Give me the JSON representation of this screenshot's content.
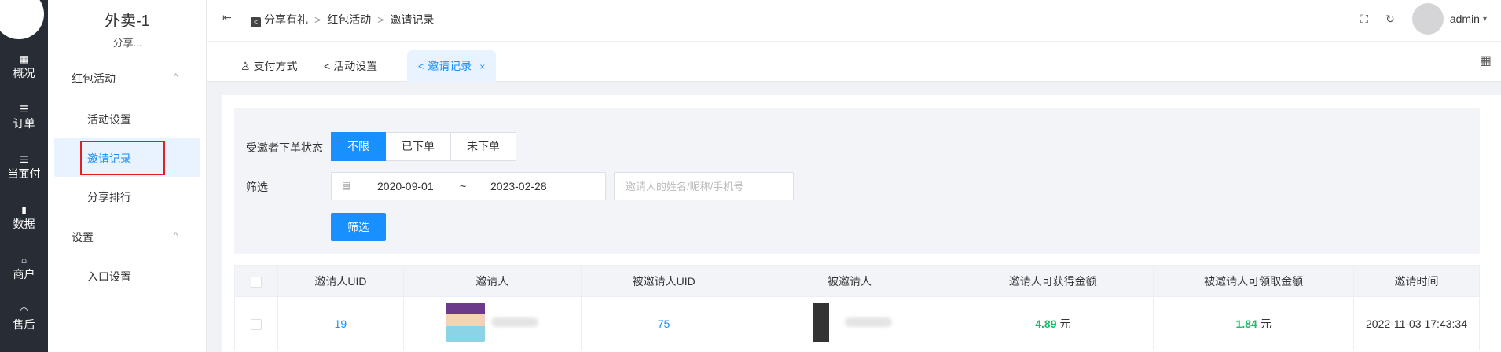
{
  "rail": {
    "items": [
      {
        "icon": "overview-icon",
        "glyph": "▦",
        "label": "概况"
      },
      {
        "icon": "orders-icon",
        "glyph": "☰",
        "label": "订单"
      },
      {
        "icon": "facepay-icon",
        "glyph": "☰",
        "label": "当面付"
      },
      {
        "icon": "data-icon",
        "glyph": "▮",
        "label": "数据"
      },
      {
        "icon": "merchant-icon",
        "glyph": "⌂",
        "label": "商户"
      },
      {
        "icon": "aftersale-icon",
        "glyph": "◠",
        "label": "售后"
      }
    ]
  },
  "subnav": {
    "title": "外卖-1",
    "subtitle": "分享...",
    "groups": [
      {
        "label": "红包活动",
        "items": [
          "活动设置",
          "邀请记录",
          "分享排行"
        ]
      },
      {
        "label": "设置",
        "items": [
          "入口设置"
        ]
      }
    ],
    "caret": "^"
  },
  "header": {
    "collapse_glyph": "⇤",
    "breadcrumbs": [
      "分享有礼",
      "红包活动",
      "邀请记录"
    ],
    "sep": ">",
    "fullscreen_glyph": "⛶",
    "refresh_glyph": "↻",
    "user": "admin",
    "user_caret": "▾"
  },
  "tabs": [
    {
      "label": "支付方式",
      "icon": "user-icon",
      "glyph": "♙"
    },
    {
      "label": "活动设置",
      "icon": "share-icon",
      "glyph": "<"
    },
    {
      "label": "邀请记录",
      "icon": "share-icon",
      "glyph": "<",
      "close": "×"
    }
  ],
  "grid_glyph": "▦",
  "filter": {
    "status_label": "受邀者下单状态",
    "status_options": [
      "不限",
      "已下单",
      "未下单"
    ],
    "selected_status": "不限",
    "range_label": "筛选",
    "date_start": "2020-09-01",
    "date_sep": "~",
    "date_end": "2023-02-28",
    "calendar_glyph": "▤",
    "search_placeholder": "邀请人的姓名/昵称/手机号",
    "submit": "筛选"
  },
  "table": {
    "headers": [
      "邀请人UID",
      "邀请人",
      "被邀请人UID",
      "被邀请人",
      "邀请人可获得金额",
      "被邀请人可领取金额",
      "邀请时间"
    ],
    "rows": [
      {
        "inviter_uid": "19",
        "invitee_uid": "75",
        "inviter_amount": "4.89",
        "invitee_amount": "1.84",
        "unit": "元",
        "time": "2022-11-03 17:43:34"
      }
    ]
  },
  "colors": {
    "primary": "#1890ff",
    "money": "#19be6b",
    "rail": "#282c34",
    "highlight": "#e02020"
  }
}
